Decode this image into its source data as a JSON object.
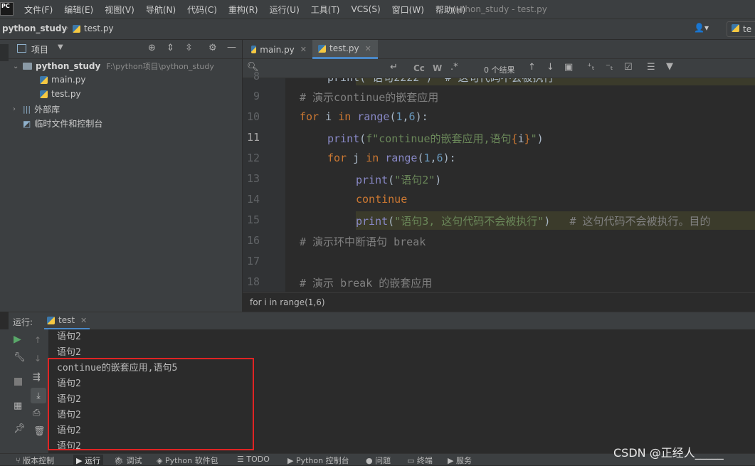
{
  "menubar": {
    "items": [
      "文件(F)",
      "编辑(E)",
      "视图(V)",
      "导航(N)",
      "代码(C)",
      "重构(R)",
      "运行(U)",
      "工具(T)",
      "VCS(S)",
      "窗口(W)",
      "帮助(H)"
    ],
    "window_title": "python_study - test.py",
    "logo": "PC"
  },
  "navbar": {
    "project": "python_study",
    "file": "test.py",
    "run_config": "te"
  },
  "project_panel": {
    "title": "项目",
    "root_name": "python_study",
    "root_path": "F:\\python项目\\python_study",
    "files": [
      "main.py",
      "test.py"
    ],
    "external_libs": "外部库",
    "scratches": "临时文件和控制台"
  },
  "tabs": [
    {
      "label": "main.py",
      "active": false
    },
    {
      "label": "test.py",
      "active": true
    }
  ],
  "search": {
    "results": "0 个结果",
    "cc": "Cc",
    "w": "W"
  },
  "editor": {
    "line_numbers": [
      "9",
      "10",
      "11",
      "12",
      "13",
      "14",
      "15",
      "16",
      "17",
      "18"
    ],
    "current_line": "11",
    "lines": {
      "l8": "print(\"语句2222\")  # 这句代码不会被执行",
      "l9": "# 演示continue的嵌套应用",
      "l10_kw1": "for",
      "l10_var": " i ",
      "l10_kw2": "in",
      "l10_fn": "range",
      "l10_rest_a": "(",
      "l10_n1": "1",
      "l10_comma": ",",
      "l10_n2": "6",
      "l10_rest_b": "):",
      "l11_fn": "print",
      "l11_a": "(",
      "l11_str1": "f\"continue的嵌套应用,语句",
      "l11_b1": "{",
      "l11_var": "i",
      "l11_b2": "}",
      "l11_str2": "\"",
      "l11_c": ")",
      "l12_kw1": "for",
      "l12_var": " j ",
      "l12_kw2": "in",
      "l12_fn": "range",
      "l12_a": "(",
      "l12_n1": "1",
      "l12_comma": ",",
      "l12_n2": "6",
      "l12_b": "):",
      "l13_fn": "print",
      "l13_a": "(",
      "l13_str": "\"语句2\"",
      "l13_b": ")",
      "l14_kw": "continue",
      "l15_fn": "print",
      "l15_a": "(",
      "l15_str": "\"语句3, 这句代码不会被执行\"",
      "l15_b": ")",
      "l15_cm": "   # 这句代码不会被执行。目的",
      "l16": "# 演示环中断语句 break",
      "l18": "# 演示 break 的嵌套应用"
    },
    "breadcrumb": "for i in range(1,6)"
  },
  "run_panel": {
    "label": "运行:",
    "tab": "test",
    "output": [
      "语句2",
      "语句2",
      "continue的嵌套应用,语句5",
      "语句2",
      "语句2",
      "语句2",
      "语句2",
      "语句2"
    ]
  },
  "statusbar": {
    "items": [
      "版本控制",
      "运行",
      "调试",
      "Python 软件包",
      "TODO",
      "Python 控制台",
      "问题",
      "终端",
      "服务"
    ]
  },
  "watermark": "CSDN @正经人_____",
  "colors": {
    "accent": "#4a88c7",
    "highlight_box": "#e02424"
  }
}
